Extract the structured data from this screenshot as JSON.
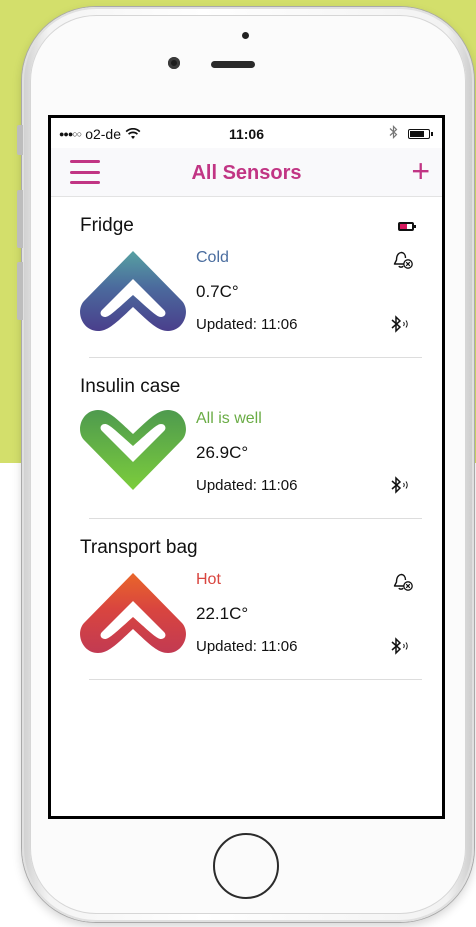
{
  "status_bar": {
    "signal_dots": "●●●○○",
    "carrier": "o2-de",
    "time": "11:06",
    "wifi_icon": "wifi-icon",
    "bluetooth_icon": "bluetooth-icon",
    "battery_icon": "battery-icon",
    "battery_level": 0.7
  },
  "nav": {
    "menu_icon": "hamburger-icon",
    "title": "All Sensors",
    "add_label": "+"
  },
  "colors": {
    "accent": "#c13584",
    "cold": "#4a6d9f",
    "ok": "#6aac45",
    "hot": "#d9453f"
  },
  "sensors": [
    {
      "name": "Fridge",
      "status": "Cold",
      "temperature": "0.7C°",
      "updated": "Updated: 11:06",
      "status_color": "#4a6d9f",
      "battery_low": true,
      "alarm_off": true,
      "logo": "up-heart-icon"
    },
    {
      "name": "Insulin case",
      "status": "All is well",
      "temperature": "26.9C°",
      "updated": "Updated: 11:06",
      "status_color": "#6aac45",
      "battery_low": false,
      "alarm_off": false,
      "logo": "heart-icon"
    },
    {
      "name": "Transport bag",
      "status": "Hot",
      "temperature": "22.1C°",
      "updated": "Updated: 11:06",
      "status_color": "#d9453f",
      "battery_low": false,
      "alarm_off": true,
      "logo": "up-heart-icon"
    }
  ]
}
